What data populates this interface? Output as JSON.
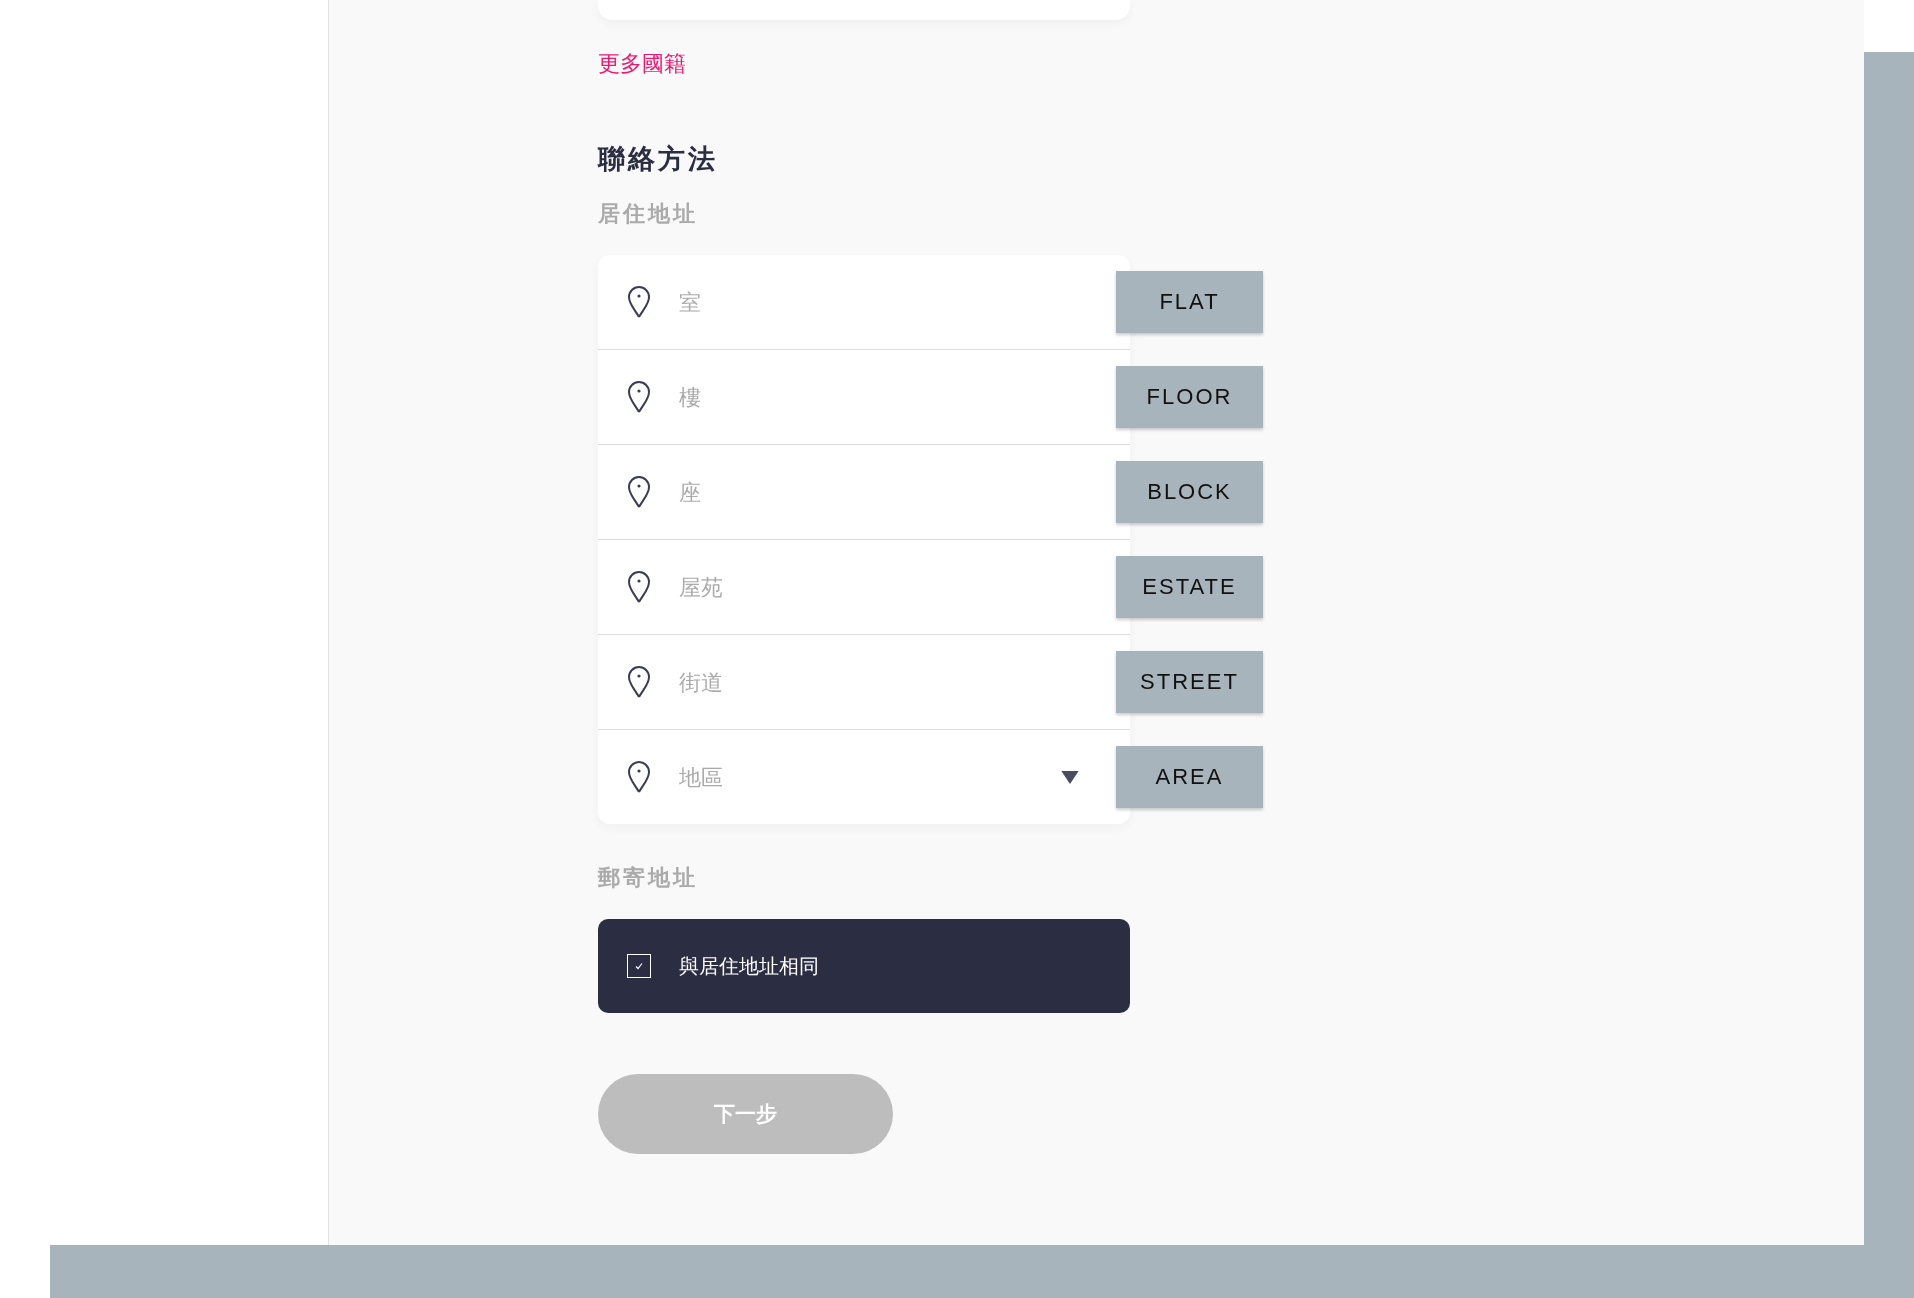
{
  "more_link": "更多國籍",
  "section_title": "聯絡方法",
  "residential": {
    "label": "居住地址",
    "fields": [
      {
        "kind": "text",
        "placeholder": "室",
        "tag": "FLAT"
      },
      {
        "kind": "text",
        "placeholder": "樓",
        "tag": "FLOOR"
      },
      {
        "kind": "text",
        "placeholder": "座",
        "tag": "BLOCK"
      },
      {
        "kind": "text",
        "placeholder": "屋苑",
        "tag": "ESTATE"
      },
      {
        "kind": "text",
        "placeholder": "街道",
        "tag": "STREET"
      },
      {
        "kind": "dropdown",
        "placeholder": "地區",
        "tag": "AREA"
      }
    ]
  },
  "postal": {
    "label": "郵寄地址",
    "same_as_residential": {
      "label": "與居住地址相同",
      "checked": true
    }
  },
  "next_button": {
    "label": "下一步",
    "disabled": true
  }
}
